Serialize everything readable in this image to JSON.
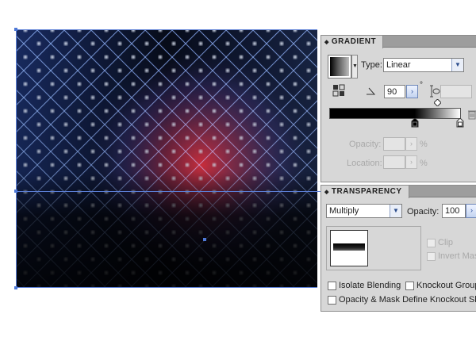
{
  "gradient_panel": {
    "tab_title": "GRADIENT",
    "type_label": "Type:",
    "type_value": "Linear",
    "angle_value": "90",
    "angle_degree": "°",
    "opacity_label": "Opacity:",
    "opacity_unit": "%",
    "location_label": "Location:",
    "location_unit": "%",
    "gradient_colors": {
      "start": "#000000",
      "end": "#ffffff"
    }
  },
  "transparency_panel": {
    "tab_title": "TRANSPARENCY",
    "blend_mode": "Multiply",
    "opacity_label": "Opacity:",
    "opacity_value": "100",
    "clip_label": "Clip",
    "invert_mask_label": "Invert Mas",
    "isolate_blending_label": "Isolate Blending",
    "knockout_group_label": "Knockout Group",
    "opacity_mask_label": "Opacity & Mask Define Knockout Shap"
  },
  "icons": {
    "panel_collapse": "diamond-arrows-icon",
    "dropdown": "chevron-down-icon",
    "reverse_gradient": "reverse-gradient-icon",
    "angle": "angle-icon",
    "aspect_ratio": "aspect-ratio-icon",
    "delete_stop": "trash-icon",
    "midpoint": "diamond-midpoint-icon",
    "color_stop": "color-stop-icon"
  }
}
